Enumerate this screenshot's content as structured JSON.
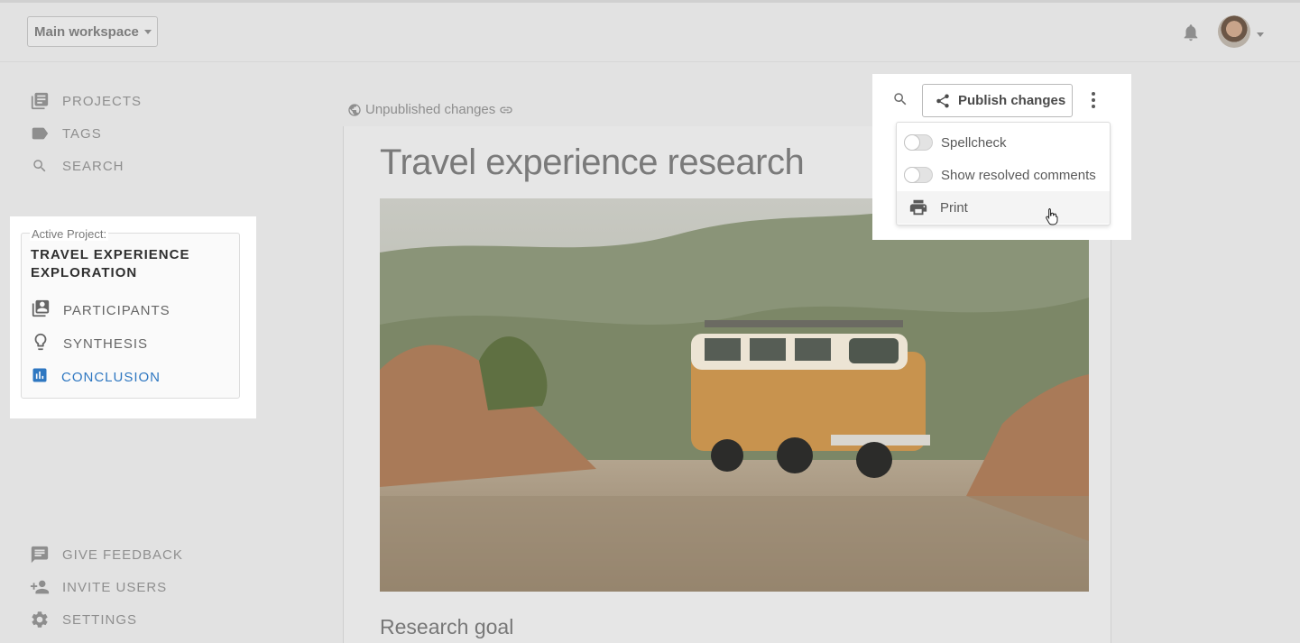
{
  "header": {
    "workspace_label": "Main workspace"
  },
  "sidebar": {
    "nav": [
      {
        "label": "PROJECTS",
        "icon": "projects-icon"
      },
      {
        "label": "TAGS",
        "icon": "tags-icon"
      },
      {
        "label": "SEARCH",
        "icon": "search-icon"
      }
    ],
    "bottom": [
      {
        "label": "GIVE FEEDBACK",
        "icon": "feedback-icon"
      },
      {
        "label": "INVITE USERS",
        "icon": "invite-user-icon"
      },
      {
        "label": "SETTINGS",
        "icon": "gear-icon"
      }
    ]
  },
  "project": {
    "legend": "Active Project:",
    "name": "TRAVEL EXPERIENCE EXPLORATION",
    "items": [
      {
        "label": "PARTICIPANTS",
        "icon": "participants-icon"
      },
      {
        "label": "SYNTHESIS",
        "icon": "lightbulb-icon"
      },
      {
        "label": "CONCLUSION",
        "icon": "bar-chart-icon",
        "active": true
      }
    ],
    "active_color": "#2e77c1"
  },
  "document": {
    "status": "Unpublished changes",
    "title": "Travel experience research",
    "section_heading": "Research goal"
  },
  "toolbar": {
    "publish_label": "Publish changes",
    "menu": [
      {
        "label": "Spellcheck",
        "type": "toggle",
        "on": false
      },
      {
        "label": "Show resolved comments",
        "type": "toggle",
        "on": false
      },
      {
        "label": "Print",
        "type": "action",
        "icon": "print-icon"
      }
    ]
  }
}
